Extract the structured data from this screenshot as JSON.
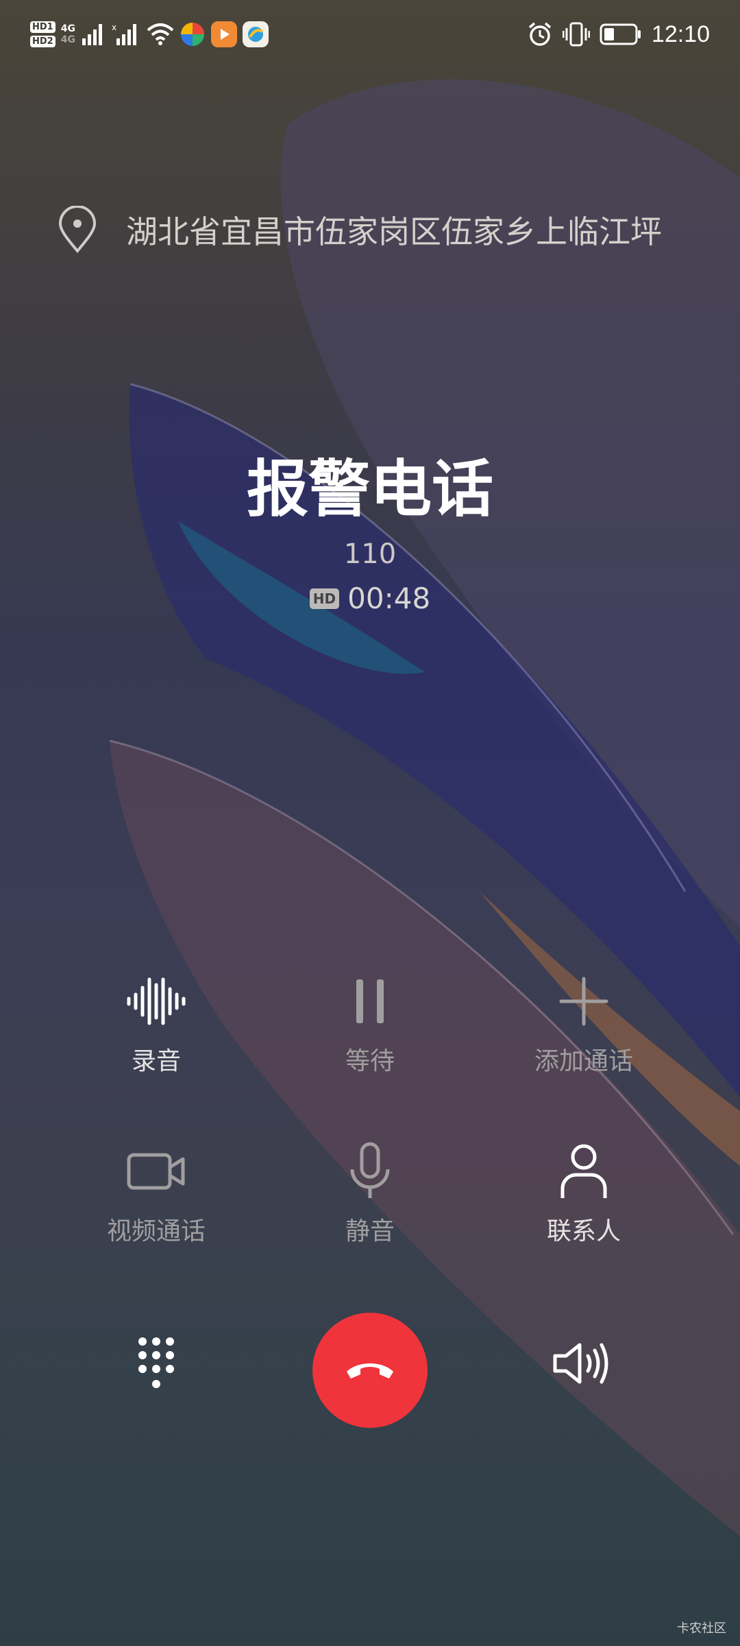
{
  "status_bar": {
    "hd_labels": [
      "HD1",
      "HD2"
    ],
    "network_labels": [
      "4G",
      "4G"
    ],
    "time": "12:10",
    "icons": [
      "signal-icon",
      "wifi-icon",
      "alarm-icon",
      "vibrate-icon",
      "battery-icon"
    ]
  },
  "call": {
    "location": "湖北省宜昌市伍家岗区伍家乡上临江坪",
    "name": "报警电话",
    "number": "110",
    "hd_badge": "HD",
    "duration": "00:48"
  },
  "actions": {
    "record": "录音",
    "hold": "等待",
    "add_call": "添加通话",
    "video_call": "视频通话",
    "mute": "静音",
    "contacts": "联系人"
  },
  "colors": {
    "hangup": "#f0343c",
    "enabled_text": "#e6e4e2",
    "disabled_text": "#a19ea0"
  },
  "watermark": "卡农社区"
}
